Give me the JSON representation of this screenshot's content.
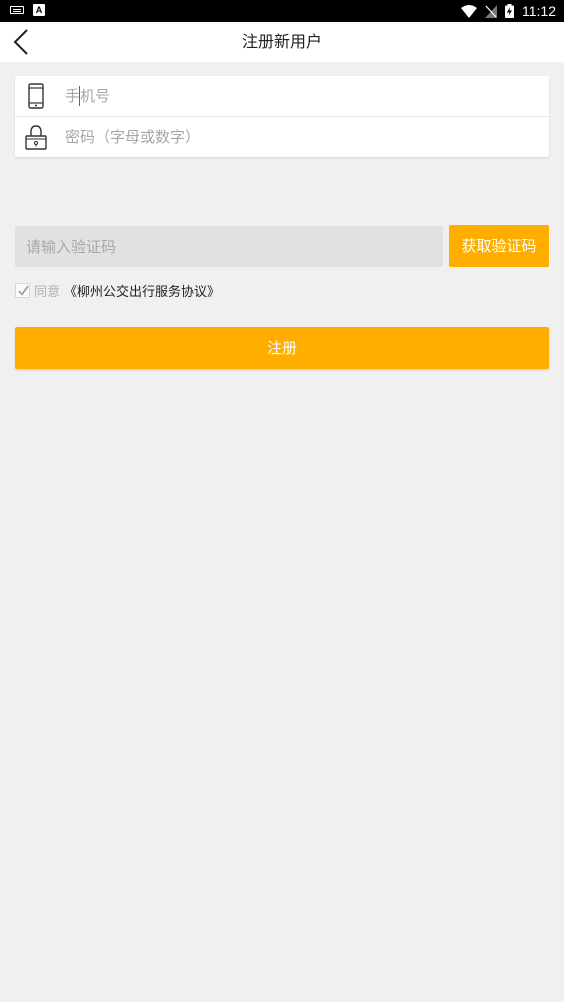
{
  "status_bar": {
    "time": "11:12",
    "icons": [
      "keyboard-icon",
      "a-badge-icon",
      "wifi-icon",
      "no-sim-icon",
      "battery-charging-icon"
    ]
  },
  "header": {
    "title": "注册新用户",
    "back_icon": "chevron-left-icon"
  },
  "form": {
    "phone": {
      "icon": "phone-icon",
      "placeholder": "手机号",
      "value": ""
    },
    "password": {
      "icon": "lock-icon",
      "placeholder": "密码（字母或数字）",
      "value": ""
    }
  },
  "verification": {
    "placeholder": "请输入验证码",
    "value": "",
    "button_label": "获取验证码"
  },
  "agreement": {
    "checked": true,
    "label": "同意",
    "link_text": "《柳州公交出行服务协议》"
  },
  "register_button": "注册",
  "colors": {
    "accent": "#ffae00",
    "background": "#f0f0f0"
  }
}
